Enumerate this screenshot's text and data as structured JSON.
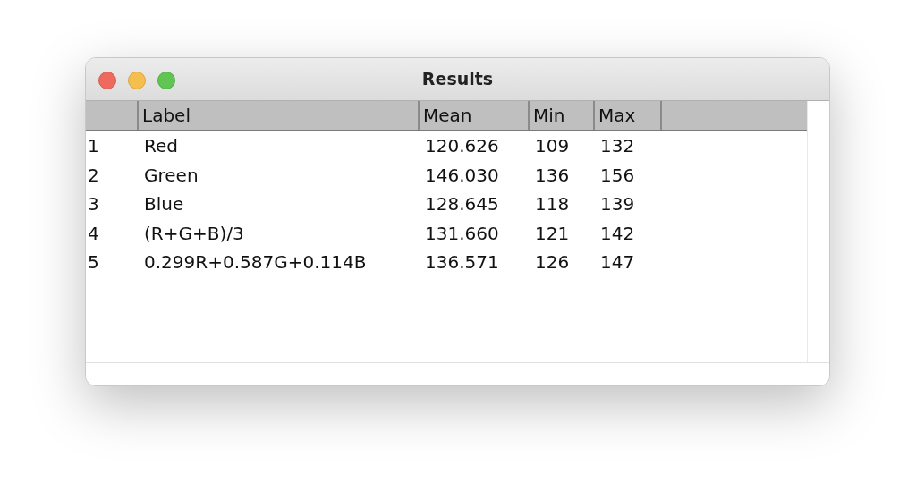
{
  "window": {
    "title": "Results"
  },
  "table": {
    "columns": [
      "Label",
      "Mean",
      "Min",
      "Max"
    ],
    "rows": [
      {
        "index": "1",
        "cells": [
          "Red",
          "120.626",
          "109",
          "132"
        ]
      },
      {
        "index": "2",
        "cells": [
          "Green",
          "146.030",
          "136",
          "156"
        ]
      },
      {
        "index": "3",
        "cells": [
          "Blue",
          "128.645",
          "118",
          "139"
        ]
      },
      {
        "index": "4",
        "cells": [
          "(R+G+B)/3",
          "131.660",
          "121",
          "142"
        ]
      },
      {
        "index": "5",
        "cells": [
          "0.299R+0.587G+0.114B",
          "136.571",
          "126",
          "147"
        ]
      }
    ]
  }
}
